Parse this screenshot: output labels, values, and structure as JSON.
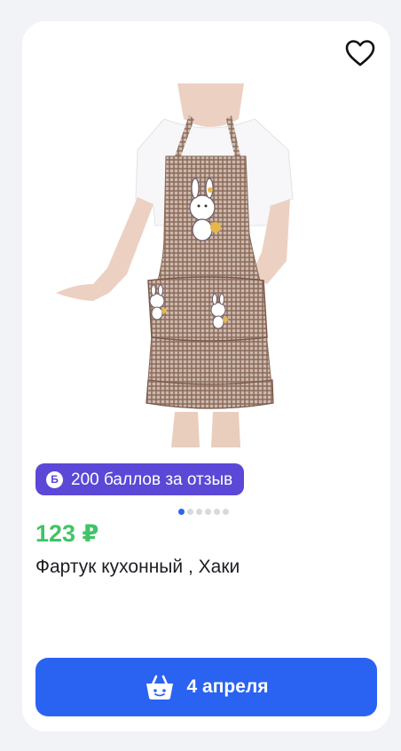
{
  "product": {
    "price": "123 ₽",
    "title": "Фартук кухонный , Хаки"
  },
  "badge": {
    "icon_letter": "Б",
    "text": "200 баллов за отзыв",
    "color": "#5b48d6"
  },
  "gallery": {
    "image_count": 6,
    "active_index": 0
  },
  "buy_button": {
    "label": "4 апреля",
    "icon": "basket-icon",
    "color": "#2a63f2"
  },
  "favorite": {
    "icon": "heart-icon"
  },
  "colors": {
    "price": "#3fc467",
    "card_background": "#ffffff",
    "page_background": "#f1f3f6"
  }
}
